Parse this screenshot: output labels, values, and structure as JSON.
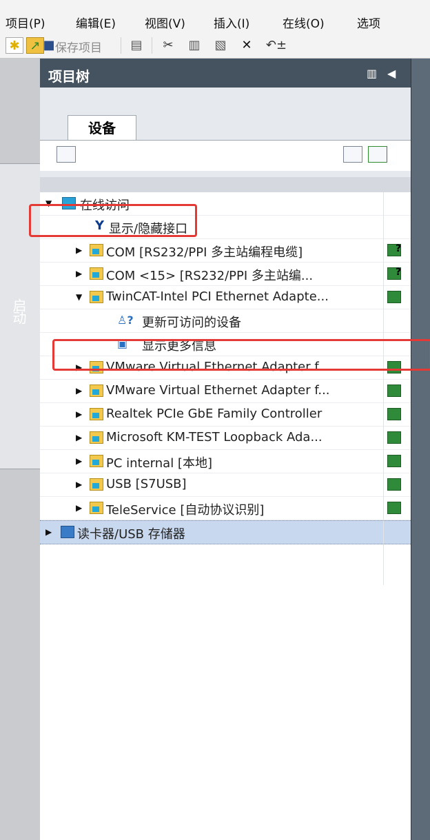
{
  "menu": [
    "项目(P)",
    "编辑(E)",
    "视图(V)",
    "插入(I)",
    "在线(O)",
    "选项"
  ],
  "toolbar": {
    "save_label": "保存项目"
  },
  "left_rail": {
    "label": "启动"
  },
  "panel": {
    "title": "项目树",
    "tab": "设备"
  },
  "tree": {
    "online_access": "在线访问",
    "show_hidden": "显示/隐藏接口",
    "com1": "COM [RS232/PPI 多主站编程电缆]",
    "com2": "COM <15> [RS232/PPI 多主站编...",
    "twincat": "TwinCAT-Intel PCI Ethernet Adapte...",
    "update_devices": "更新可访问的设备",
    "more_info": "显示更多信息",
    "vmware1": "VMware Virtual Ethernet Adapter f...",
    "vmware2": "VMware Virtual Ethernet Adapter f...",
    "realtek": "Realtek PCIe GbE Family Controller",
    "microsoft": "Microsoft KM-TEST Loopback Ada...",
    "pc_internal": "PC internal [本地]",
    "usb": "USB [S7USB]",
    "teleservice": "TeleService [自动协议识别]",
    "card_reader": "读卡器/USB 存储器"
  },
  "colors": {
    "header_bg": "#45525f",
    "highlight": "#e53935",
    "status_green": "#2f8a3a"
  }
}
